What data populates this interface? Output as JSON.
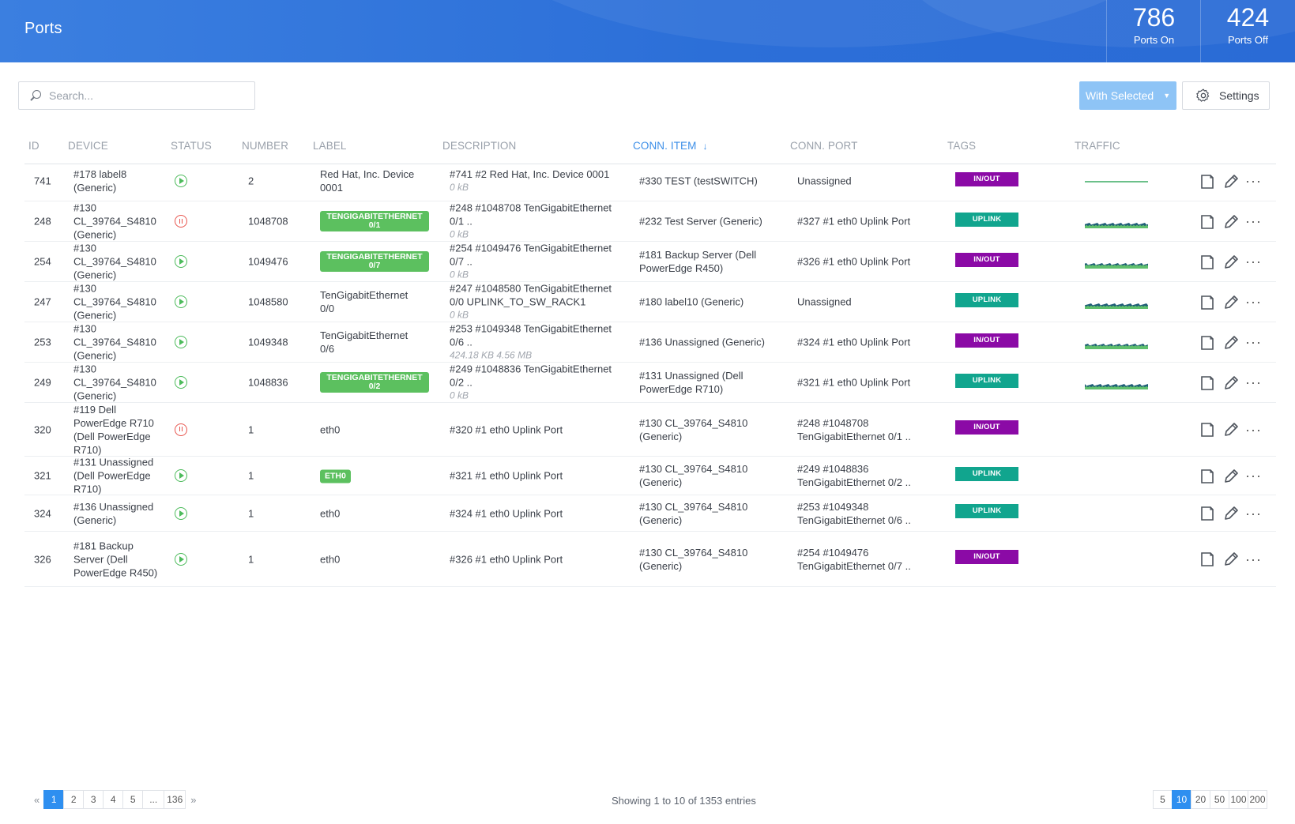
{
  "header": {
    "title": "Ports",
    "stats": [
      {
        "value": "786",
        "label": "Ports On"
      },
      {
        "value": "424",
        "label": "Ports Off"
      }
    ]
  },
  "toolbar": {
    "search_placeholder": "Search...",
    "with_selected_label": "With Selected",
    "settings_label": "Settings"
  },
  "table": {
    "columns": [
      "ID",
      "DEVICE",
      "STATUS",
      "NUMBER",
      "LABEL",
      "DESCRIPTION",
      "CONN. ITEM",
      "CONN. PORT",
      "TAGS",
      "TRAFFIC"
    ],
    "sorted_column": "CONN. ITEM",
    "rows": [
      {
        "id": "741",
        "device": "#178 label8 (Generic)",
        "status": "on",
        "number": "2",
        "label": "Red Hat, Inc. Device 0001",
        "label_badge": false,
        "description": "#741 #2 Red Hat, Inc. Device 0001",
        "traffic_text": "0 kB",
        "conn_item": "#330 TEST (testSWITCH)",
        "conn_port": "Unassigned",
        "tag": "IN/OUT",
        "traffic_graph": "flat"
      },
      {
        "id": "248",
        "device": "#130 CL_39764_S4810 (Generic)",
        "status": "off",
        "number": "1048708",
        "label": "TENGIGABITETHERNET 0/1",
        "label_badge": true,
        "description": "#248 #1048708 TenGigabitEthernet 0/1 ..",
        "traffic_text": "0 kB",
        "conn_item": "#232 Test Server (Generic)",
        "conn_port": "#327 #1 eth0 Uplink Port",
        "tag": "UPLINK",
        "traffic_graph": "noisy"
      },
      {
        "id": "254",
        "device": "#130 CL_39764_S4810 (Generic)",
        "status": "on",
        "number": "1049476",
        "label": "TENGIGABITETHERNET 0/7",
        "label_badge": true,
        "description": "#254 #1049476 TenGigabitEthernet 0/7 ..",
        "traffic_text": "0 kB",
        "conn_item": "#181 Backup Server (Dell PowerEdge R450)",
        "conn_port": "#326 #1 eth0 Uplink Port",
        "tag": "IN/OUT",
        "traffic_graph": "noisy"
      },
      {
        "id": "247",
        "device": "#130 CL_39764_S4810 (Generic)",
        "status": "on",
        "number": "1048580",
        "label": "TenGigabitEthernet 0/0",
        "label_badge": false,
        "description": "#247 #1048580 TenGigabitEthernet 0/0 UPLINK_TO_SW_RACK1",
        "traffic_text": "0 kB",
        "conn_item": "#180 label10 (Generic)",
        "conn_port": "Unassigned",
        "tag": "UPLINK",
        "traffic_graph": "noisy"
      },
      {
        "id": "253",
        "device": "#130 CL_39764_S4810 (Generic)",
        "status": "on",
        "number": "1049348",
        "label": "TenGigabitEthernet 0/6",
        "label_badge": false,
        "description": "#253 #1049348 TenGigabitEthernet 0/6 ..",
        "traffic_text": "424.18 KB 4.56 MB",
        "conn_item": "#136 Unassigned (Generic)",
        "conn_port": "#324 #1 eth0 Uplink Port",
        "tag": "IN/OUT",
        "traffic_graph": "noisy"
      },
      {
        "id": "249",
        "device": "#130 CL_39764_S4810 (Generic)",
        "status": "on",
        "number": "1048836",
        "label": "TENGIGABITETHERNET 0/2",
        "label_badge": true,
        "description": "#249 #1048836 TenGigabitEthernet 0/2 ..",
        "traffic_text": "0 kB",
        "conn_item": "#131 Unassigned (Dell PowerEdge R710)",
        "conn_port": "#321 #1 eth0 Uplink Port",
        "tag": "UPLINK",
        "traffic_graph": "noisy"
      },
      {
        "id": "320",
        "device": "#119 Dell PowerEdge R710 (Dell PowerEdge R710)",
        "status": "off",
        "number": "1",
        "label": "eth0",
        "label_badge": false,
        "description": "#320 #1 eth0 Uplink Port",
        "traffic_text": "",
        "conn_item": "#130 CL_39764_S4810 (Generic)",
        "conn_port": "#248 #1048708 TenGigabitEthernet 0/1 ..",
        "tag": "IN/OUT",
        "traffic_graph": "none"
      },
      {
        "id": "321",
        "device": "#131 Unassigned (Dell PowerEdge R710)",
        "status": "on",
        "number": "1",
        "label": "ETH0",
        "label_badge": true,
        "description": "#321 #1 eth0 Uplink Port",
        "traffic_text": "",
        "conn_item": "#130 CL_39764_S4810 (Generic)",
        "conn_port": "#249 #1048836 TenGigabitEthernet 0/2 ..",
        "tag": "UPLINK",
        "traffic_graph": "none"
      },
      {
        "id": "324",
        "device": "#136 Unassigned (Generic)",
        "status": "on",
        "number": "1",
        "label": "eth0",
        "label_badge": false,
        "description": "#324 #1 eth0 Uplink Port",
        "traffic_text": "",
        "conn_item": "#130 CL_39764_S4810 (Generic)",
        "conn_port": "#253 #1049348 TenGigabitEthernet 0/6 ..",
        "tag": "UPLINK",
        "traffic_graph": "none"
      },
      {
        "id": "326",
        "device": "#181 Backup Server (Dell PowerEdge R450)",
        "status": "on",
        "number": "1",
        "label": "eth0",
        "label_badge": false,
        "description": "#326 #1 eth0 Uplink Port",
        "traffic_text": "",
        "conn_item": "#130 CL_39764_S4810 (Generic)",
        "conn_port": "#254 #1049476 TenGigabitEthernet 0/7 ..",
        "tag": "IN/OUT",
        "traffic_graph": "none"
      }
    ]
  },
  "pagination": {
    "pages": [
      "1",
      "2",
      "3",
      "4",
      "5",
      "...",
      "136"
    ],
    "current": "1",
    "showing_text": "Showing 1 to 10 of 1353 entries",
    "page_sizes": [
      "5",
      "10",
      "20",
      "50",
      "100",
      "200"
    ],
    "current_size": "10"
  },
  "colors": {
    "header_blue": "#2c6fd8",
    "accent_blue": "#2e8ff0",
    "tag_inout": "#8b0aa6",
    "tag_uplink": "#11a58e",
    "status_on": "#4cbb5b",
    "status_off": "#e8554e",
    "label_badge": "#5cc05f"
  }
}
